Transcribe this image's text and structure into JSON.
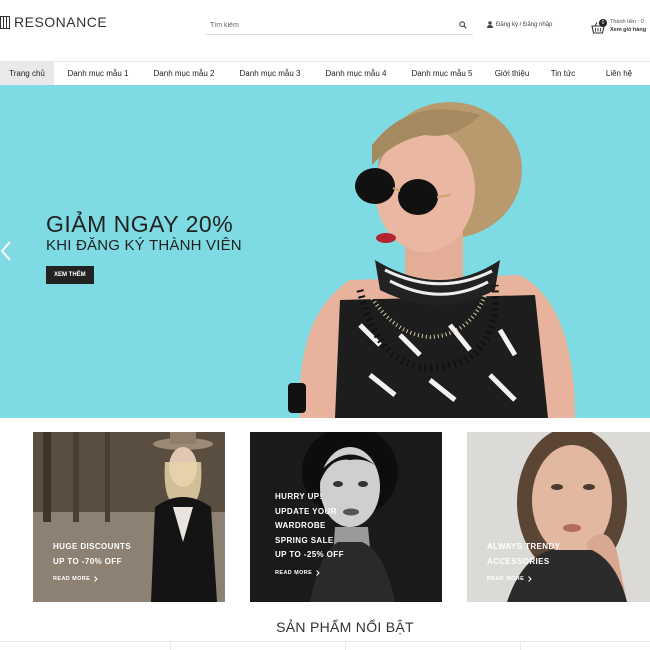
{
  "header": {
    "logo": "RESONANCE",
    "search_placeholder": "Tìm kiếm",
    "account_text": "Đăng ký / Đăng nhập",
    "cart_count": "0",
    "cart_line1": "Thành tiền : 0",
    "cart_line2": "Xem giỏ hàng"
  },
  "nav": {
    "items": [
      {
        "label": "Trang chủ"
      },
      {
        "label": "Danh mục mẫu 1"
      },
      {
        "label": "Danh mục mẫu 2"
      },
      {
        "label": "Danh mục mẫu 3"
      },
      {
        "label": "Danh mục mẫu 4"
      },
      {
        "label": "Danh mục mẫu 5"
      },
      {
        "label": "Giới thiệu"
      },
      {
        "label": "Tin tức"
      },
      {
        "label": "Liên hệ"
      }
    ]
  },
  "hero": {
    "title": "GIẢM NGAY 20%",
    "subtitle": "KHI ĐĂNG KÝ THÀNH VIÊN",
    "button": "XEM THÊM"
  },
  "banners": [
    {
      "lines": [
        "HUGE DISCOUNTS",
        "UP TO -70% OFF"
      ],
      "link": "READ MORE"
    },
    {
      "lines": [
        "HURRY UP!",
        "UPDATE YOUR",
        "WARDROBE",
        "SPRING SALE",
        "UP TO -25% OFF"
      ],
      "link": "READ MORE"
    },
    {
      "lines": [
        "ALWAYS TRENDY",
        "ACCESSORIES"
      ],
      "link": "READ MORE"
    }
  ],
  "section": {
    "title": "SẢN PHẨM NỔI BẬT"
  },
  "colors": {
    "hero_bg": "#7fdbe3",
    "dark_button": "#222222",
    "active_nav": "#e9e9e9"
  }
}
